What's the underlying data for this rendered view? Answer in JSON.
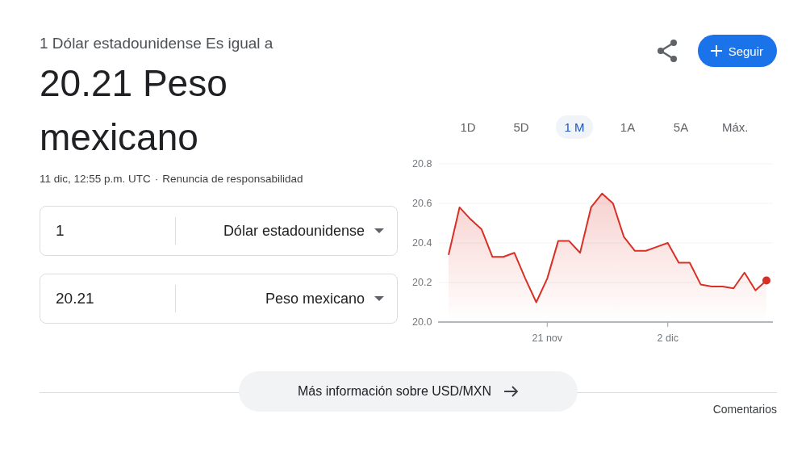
{
  "header": {
    "subtitle": "1 Dólar estadounidense Es igual a",
    "result": "20.21 Peso mexicano",
    "timestamp": "11 dic, 12:55 p.m. UTC",
    "separator": "·",
    "disclaimer": "Renuncia de responsabilidad"
  },
  "actions": {
    "follow_label": "Seguir"
  },
  "converter": [
    {
      "amount": "1",
      "currency": "Dólar estadounidense"
    },
    {
      "amount": "20.21",
      "currency": "Peso mexicano"
    }
  ],
  "ranges": [
    {
      "label": "1D",
      "selected": false
    },
    {
      "label": "5D",
      "selected": false
    },
    {
      "label": "1 M",
      "selected": true
    },
    {
      "label": "1A",
      "selected": false
    },
    {
      "label": "5A",
      "selected": false
    },
    {
      "label": "Máx.",
      "selected": false
    }
  ],
  "chart_data": {
    "type": "area",
    "categories": [
      null,
      null,
      null,
      null,
      null,
      null,
      null,
      null,
      null,
      "21 nov",
      null,
      null,
      null,
      null,
      null,
      null,
      null,
      null,
      null,
      null,
      "2 dic",
      null,
      null,
      null,
      null,
      null,
      null,
      null,
      null,
      null
    ],
    "series": [
      {
        "color": "#d93025",
        "values": [
          20.34,
          20.58,
          20.52,
          20.47,
          20.33,
          20.33,
          20.35,
          20.22,
          20.1,
          20.22,
          20.41,
          20.41,
          20.35,
          20.58,
          20.65,
          20.6,
          20.43,
          20.36,
          20.36,
          20.38,
          20.4,
          20.3,
          20.3,
          20.19,
          20.18,
          20.18,
          20.17,
          20.25,
          20.16,
          20.21
        ]
      }
    ],
    "ylim": [
      20,
      20.8
    ],
    "grid": true,
    "yticks": [
      {
        "value": 20,
        "label": "20.0"
      },
      {
        "value": 20.2,
        "label": "20.2"
      },
      {
        "value": 20.4,
        "label": "20.4"
      },
      {
        "value": 20.6,
        "label": "20.6"
      },
      {
        "value": 20.8,
        "label": "20.8"
      }
    ]
  },
  "footer": {
    "more_info": "Más información sobre USD/MXN",
    "feedback": "Comentarios"
  }
}
